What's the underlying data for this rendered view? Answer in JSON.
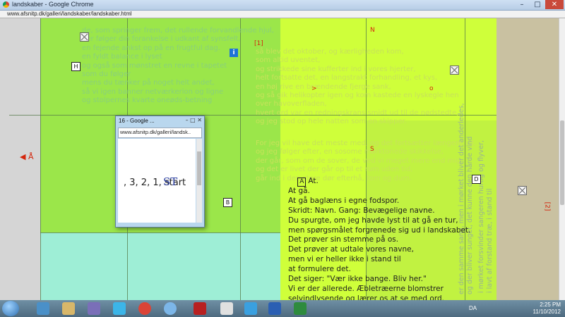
{
  "window": {
    "title": "landskaber - Google Chrome",
    "url": "www.afsnitp.dk/galleri/landskaber/landskaber.html",
    "minimize": "–",
    "maximize": "□",
    "close": "✕"
  },
  "page": {
    "marks": {
      "top_n": "N",
      "bracket_1": "[1]",
      "bracket_2": "[2]",
      "gt": ">",
      "circle": "o",
      "s_mark": "S",
      "back": "◀ Å"
    },
    "boxes": {
      "h": "H",
      "a": "A",
      "b": "B",
      "d": "D",
      "info": "i"
    },
    "ghost_left": "de, som springer frem, det rullende forvandlende hjul,\nder følger din forankelse i udkant af synsfelt,\nen fejende ankst op på en frugtful dag.\nen fyldt balance i lyset\nog også som mønstret en revne i tapetet\nsom du følger\nmens du tænker på noget helt andet,\nså vi igen banner netværkerion og ligne\nog stolpernes kvarte oneøds-betning",
    "ghost_right": "så blev det oktober, og kærligheden kom,\nsom altid uventet,\nog strikkede sine kufferter ind i vores hjerter,\nhelt fortsatte det, en langstrakt forhandling, et kys,\nen høj rive en brændende fjerge sank,\nog så gik helikopter igen og kom kastede en lyskegle hen\nover havoverfladen,\nhvert ord var en redningskrans smidt ud til de nødstedte,\nog jeg stod op hele natten som en skipper.",
    "ghost_right2": "For jeg vil have det meste med, og det fortsætter længere ud,\nog jeg følger efter, en sosome mørktonede skikkelse,\nder går, som om de sover, de ved vi meget mere end mig,\nog det er livet der går op til et rum uden tid,\ngår ind i den store dør efterhå, tom og dum.",
    "ghost_vertical_1": "er den samme sang, men i mørket bliver det anderledes,\nog der bliver sunget, det kunne den hårde vind",
    "ghost_vertical_2": "i mørket forsvinder sangeren hurtig og flyver,\ni lavt af forstand træ, i stand til",
    "poem": [
      "At.",
      "At gå.",
      "At gå baglæns i egne fodspor.",
      "Skridt: Navn. Gang: Bevægelige navne.",
      "Du spurgte, om jeg havde lyst til at gå en tur,",
      "men spørgsmålet forgrenede sig ud i landskabet.",
      "Det prøver sin stemme på os.",
      "Det prøver at udtale vores navne,",
      "men vi er heller ikke i stand til",
      "at formulere det.",
      "Det siger: \"Vær ikke bange. Bliv her.\"",
      "Vi er der allerede. Æbletræerne blomstrer",
      "selvindlysende og lærer os at se med ord."
    ]
  },
  "popup": {
    "title": "16 - Google ...",
    "url": "www.afsnitp.dk/galleri/landsk...",
    "handwriting": ", 3, 2, 1, start",
    "handwriting_2": "ST",
    "buttons": "–  □  ✕"
  },
  "taskbar": {
    "language": "DA",
    "time": "2:25 PM",
    "date": "11/10/2012",
    "apps": [
      "explorer-icon",
      "file-manager-icon",
      "media-player-icon",
      "app-icon",
      "skype-icon",
      "chrome-icon",
      "itunes-icon",
      "flash-icon",
      "scrivener-icon",
      "bic-icon",
      "word-icon",
      "excel-icon"
    ]
  },
  "colors": {
    "lime": "#cfff3a",
    "green": "#9be64a",
    "aqua": "#9eeed6",
    "khaki": "#c9c1a1",
    "red_mark": "#d4260d"
  }
}
